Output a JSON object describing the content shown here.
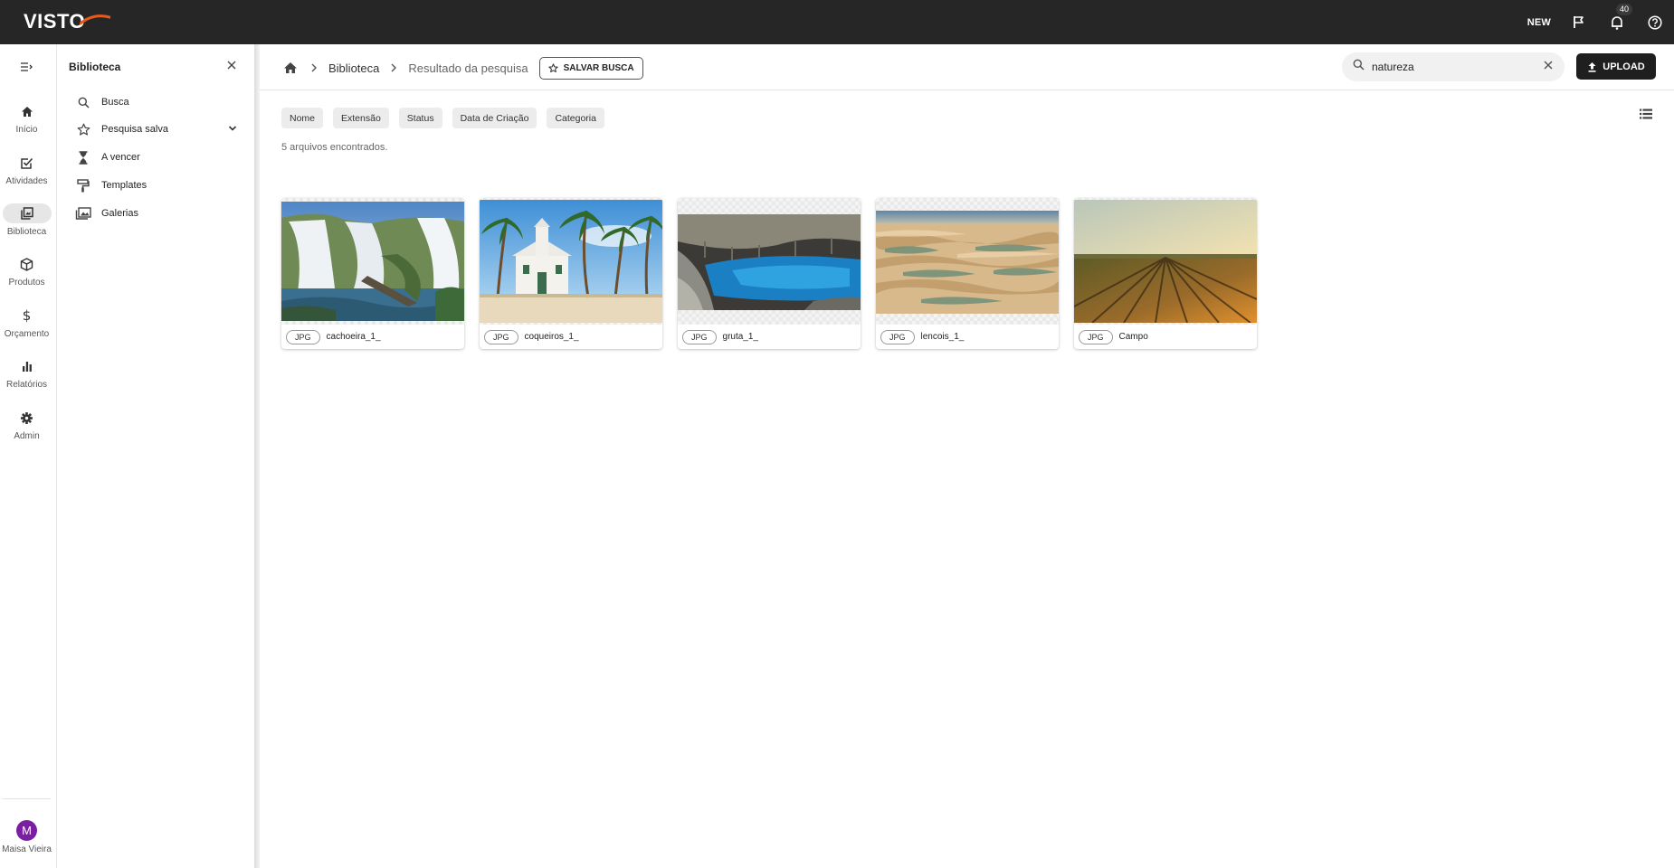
{
  "app": {
    "logo": "VISTO",
    "top_new": "NEW",
    "notifications_count": "40"
  },
  "rail": {
    "items": [
      {
        "label": "Início",
        "icon": "home-icon"
      },
      {
        "label": "Atividades",
        "icon": "checkbox-icon"
      },
      {
        "label": "Biblioteca",
        "icon": "library-icon",
        "active": true
      },
      {
        "label": "Produtos",
        "icon": "cube-icon"
      },
      {
        "label": "Orçamento",
        "icon": "dollar-icon"
      },
      {
        "label": "Relatórios",
        "icon": "bar-chart-icon"
      },
      {
        "label": "Admin",
        "icon": "gear-icon"
      }
    ],
    "user": {
      "initial": "M",
      "name": "Maisa Vieira",
      "avatar_color": "#7b1fa2"
    }
  },
  "panel": {
    "title": "Biblioteca",
    "items": [
      {
        "label": "Busca",
        "icon": "search-icon"
      },
      {
        "label": "Pesquisa salva",
        "icon": "star-icon"
      },
      {
        "label": "A vencer",
        "icon": "hourglass-icon"
      },
      {
        "label": "Templates",
        "icon": "paint-roller-icon"
      },
      {
        "label": "Galerias",
        "icon": "gallery-icon"
      }
    ]
  },
  "header": {
    "breadcrumb": {
      "home_icon": "home-icon",
      "level1": "Biblioteca",
      "current": "Resultado da pesquisa"
    },
    "save_search": "SALVAR BUSCA",
    "search_value": "natureza",
    "upload": "UPLOAD"
  },
  "filters": [
    "Nome",
    "Extensão",
    "Status",
    "Data de Criação",
    "Categoria"
  ],
  "results_count": "5 arquivos encontrados.",
  "files": [
    {
      "ext": "JPG",
      "name": "cachoeira_1_",
      "subject": "waterfall"
    },
    {
      "ext": "JPG",
      "name": "coqueiros_1_",
      "subject": "palm beach church"
    },
    {
      "ext": "JPG",
      "name": "gruta_1_",
      "subject": "blue cave lake"
    },
    {
      "ext": "JPG",
      "name": "lencois_1_",
      "subject": "sand dunes"
    },
    {
      "ext": "JPG",
      "name": "Campo",
      "subject": "vineyard field"
    }
  ],
  "colors": {
    "topbar": "#262626",
    "accent": "#e8591a",
    "button_dark": "#1f1f1f"
  }
}
